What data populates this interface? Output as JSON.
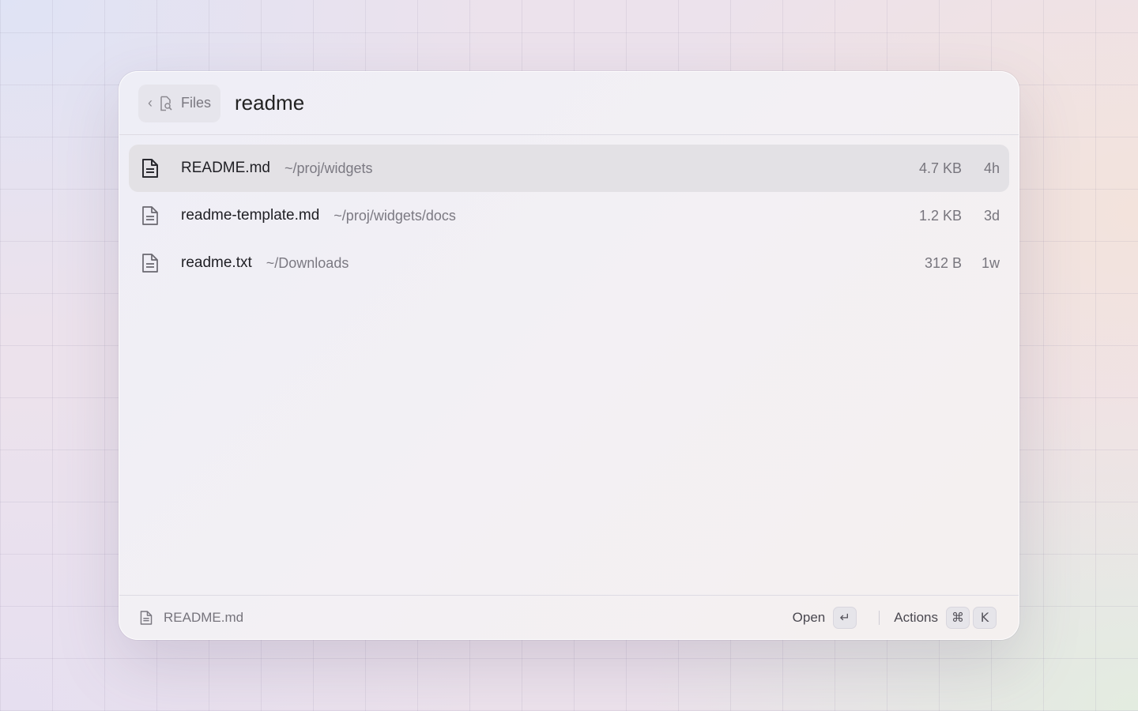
{
  "header": {
    "back_label": "Files",
    "search_value": "readme",
    "search_placeholder": ""
  },
  "results": [
    {
      "name": "README.md",
      "path": "~/proj/widgets",
      "size": "4.7 KB",
      "age": "4h",
      "selected": true
    },
    {
      "name": "readme-template.md",
      "path": "~/proj/widgets/docs",
      "size": "1.2 KB",
      "age": "3d",
      "selected": false
    },
    {
      "name": "readme.txt",
      "path": "~/Downloads",
      "size": "312 B",
      "age": "1w",
      "selected": false
    }
  ],
  "footer": {
    "selected_name": "README.md",
    "open_label": "Open",
    "open_key": "↵",
    "actions_label": "Actions",
    "actions_keys": [
      "⌘",
      "K"
    ]
  },
  "icons": {
    "back": "chevron-left-icon",
    "files": "file-search-icon",
    "document": "document-icon"
  }
}
